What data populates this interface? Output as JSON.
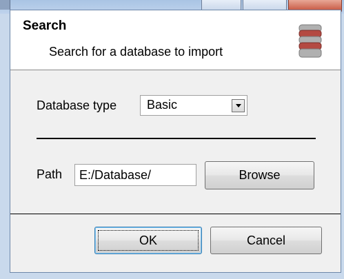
{
  "dialog": {
    "title": "Search",
    "subtitle": "Search for a database to import"
  },
  "database_type": {
    "label": "Database type",
    "selected": "Basic"
  },
  "path": {
    "label": "Path",
    "value": "E:/Database/"
  },
  "buttons": {
    "browse": "Browse",
    "ok": "OK",
    "cancel": "Cancel"
  },
  "icons": {
    "header_icon": "database-icon",
    "dropdown": "chevron-down-icon"
  },
  "colors": {
    "header_bg": "#ffffff",
    "body_bg": "#f0f0f0",
    "icon_red": "#b44a42",
    "icon_gray": "#b0b0b0"
  }
}
